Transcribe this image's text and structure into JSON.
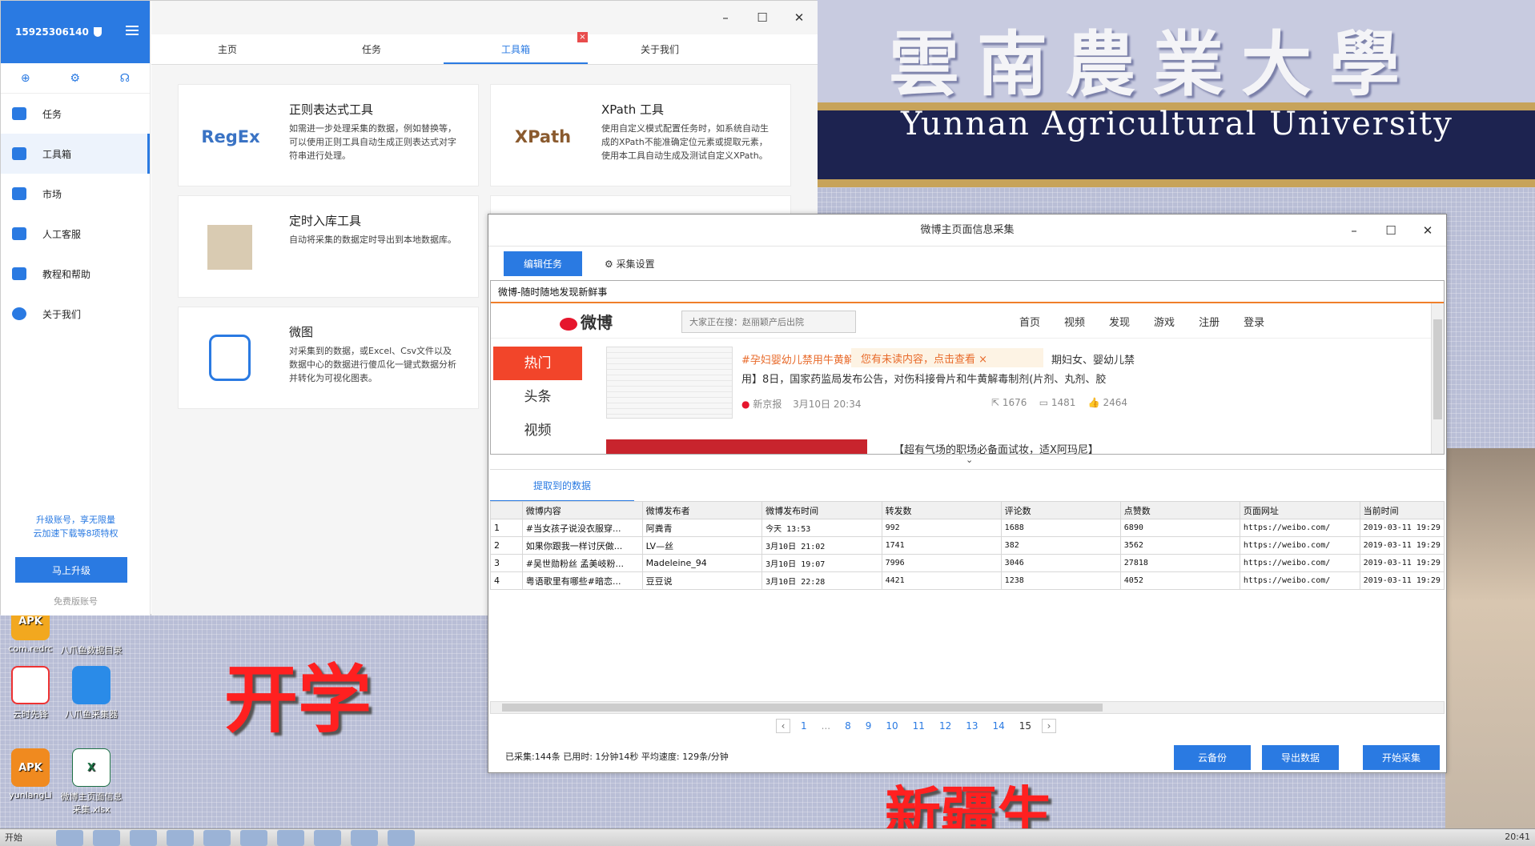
{
  "app": {
    "account": "15925306140",
    "sidebar": {
      "items": [
        {
          "label": "任务"
        },
        {
          "label": "工具箱"
        },
        {
          "label": "市场"
        },
        {
          "label": "人工客服"
        },
        {
          "label": "教程和帮助"
        },
        {
          "label": "关于我们"
        }
      ],
      "promo_line1": "升级账号，享无限量",
      "promo_line2": "云加速下载等8项特权",
      "upgrade_label": "马上升级",
      "account_type": "免费版账号"
    },
    "tabs": [
      {
        "label": "主页"
      },
      {
        "label": "任务"
      },
      {
        "label": "工具箱"
      },
      {
        "label": "关于我们"
      }
    ],
    "tab_close": "×",
    "cards": [
      {
        "logo": "RegEx",
        "title": "正则表达式工具",
        "desc": "如需进一步处理采集的数据，例如替换等，可以使用正则工具自动生成正则表达式对字符串进行处理。"
      },
      {
        "logo": "XPath",
        "title": "XPath 工具",
        "desc": "使用自定义模式配置任务时，如系统自动生成的XPath不能准确定位元素或提取元素，使用本工具自动生成及测试自定义XPath。"
      },
      {
        "logo": "",
        "title": "定时入库工具",
        "desc": "自动将采集的数据定时导出到本地数据库。"
      },
      {
        "logo": "",
        "title": "微图",
        "desc": "对采集到的数据，或Excel、Csv文件以及数据中心的数据进行傻瓜化一键式数据分析并转化为可视化图表。"
      }
    ]
  },
  "desktop": {
    "uni_cn": "雲南農業大學",
    "uni_en": "Yunnan Agricultural University",
    "banner1": "开学",
    "banner2": "新疆生",
    "icons": [
      {
        "label": "com.redrc",
        "glyph": "APK"
      },
      {
        "label": "八爪鱼数据目录",
        "glyph": ""
      },
      {
        "label": "云时先锋",
        "glyph": ""
      },
      {
        "label": "八爪鱼采集器",
        "glyph": ""
      },
      {
        "label": "yunlangLi",
        "glyph": "APK"
      },
      {
        "label": "微博主页面信息采集.xlsx",
        "glyph": "X"
      }
    ],
    "taskbar_start": "开始",
    "clock": "20:41"
  },
  "dialog": {
    "title": "微博主页面信息采集",
    "edit_label": "编辑任务",
    "settings_label": "采集设置",
    "browser_title": "微博-随时随地发现新鲜事",
    "weibo": {
      "logo": "微博",
      "search_placeholder": "大家正在搜：赵丽颖产后出院",
      "nav": [
        "首页",
        "视频",
        "发现",
        "游戏",
        "注册",
        "登录"
      ],
      "side": [
        "热门",
        "头条",
        "视频"
      ],
      "post_tag": "#孕妇婴幼儿禁用牛黄解",
      "unread": "您有未读内容，点击查看 ×",
      "post_tail": "期妇女、婴幼儿禁",
      "post_line2": "用】8日，国家药监局发布公告，对伤科接骨片和牛黄解毒制剂(片剂、丸剂、胶",
      "post_source": "新京报",
      "post_time": "3月10日 20:34",
      "reposts": "1676",
      "comments": "1481",
      "likes": "2464",
      "next_post": "【超有气场的职场必备面试妆，适X阿玛尼】"
    },
    "data_tab": "提取到的数据",
    "columns": [
      "",
      "微博内容",
      "微博发布者",
      "微博发布时间",
      "转发数",
      "评论数",
      "点赞数",
      "页面网址",
      "当前时间"
    ],
    "rows": [
      [
        "1",
        "#当女孩子说没衣服穿...",
        "阿粪青",
        "今天 13:53",
        "992",
        "1688",
        "6890",
        "https://weibo.com/",
        "2019-03-11 19:29"
      ],
      [
        "2",
        "如果你跟我一样讨厌做...",
        "LV—丝",
        "3月10日 21:02",
        "1741",
        "382",
        "3562",
        "https://weibo.com/",
        "2019-03-11 19:29"
      ],
      [
        "3",
        "#吴世勋粉丝 孟美岐粉...",
        "Madeleine_94",
        "3月10日 19:07",
        "7996",
        "3046",
        "27818",
        "https://weibo.com/",
        "2019-03-11 19:29"
      ],
      [
        "4",
        "粤语歌里有哪些#暗恋...",
        "豆豆说",
        "3月10日 22:28",
        "4421",
        "1238",
        "4052",
        "https://weibo.com/",
        "2019-03-11 19:29"
      ]
    ],
    "pager": {
      "prev": "‹",
      "pages": [
        "1",
        "...",
        "8",
        "9",
        "10",
        "11",
        "12",
        "13",
        "14",
        "15"
      ],
      "next": "›",
      "current": "15"
    },
    "stats": "已采集:144条  已用时: 1分钟14秒  平均速度: 129条/分钟",
    "backup_label": "云备份",
    "export_label": "导出数据",
    "start_label": "开始采集"
  }
}
